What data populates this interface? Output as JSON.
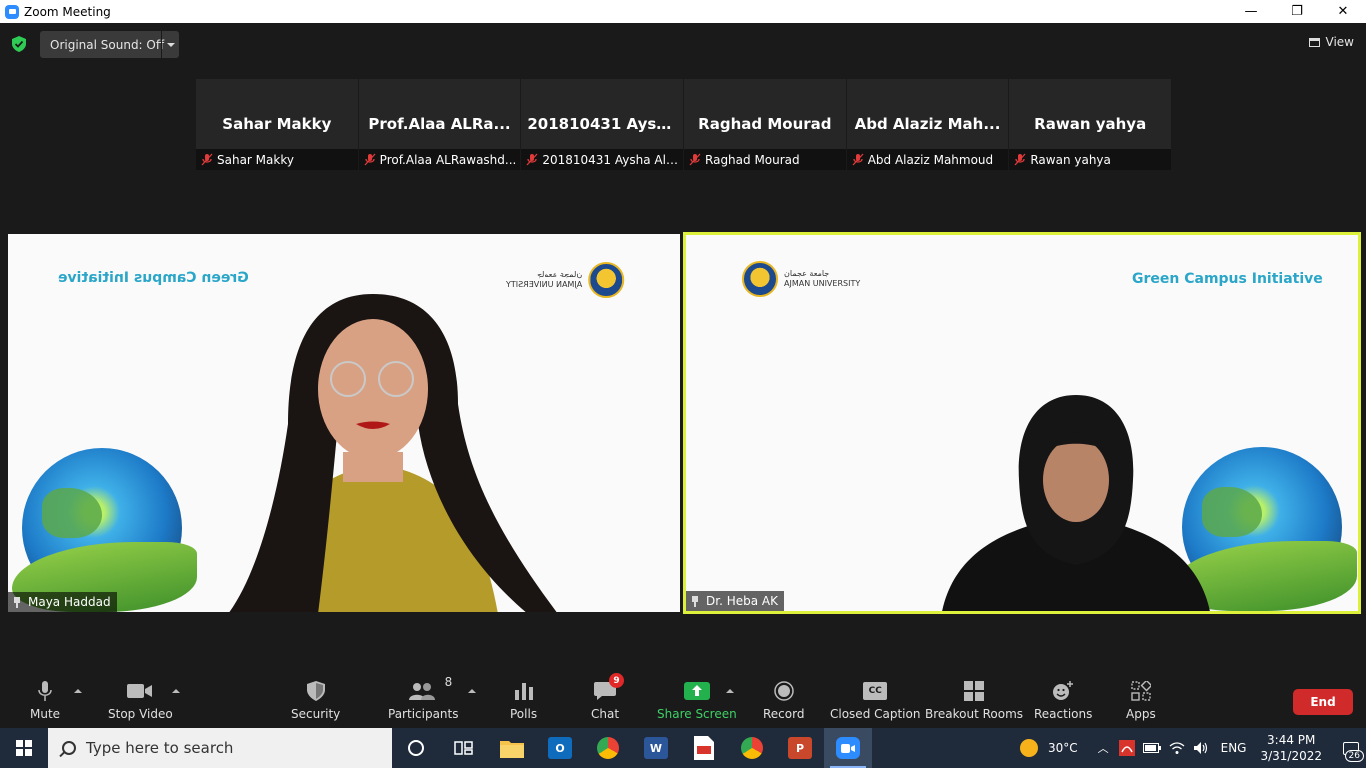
{
  "window": {
    "title": "Zoom Meeting",
    "minimize": "—",
    "restore": "❐",
    "close": "✕"
  },
  "top_bar": {
    "original_sound": "Original Sound: Off",
    "view_label": "View"
  },
  "participants_strip": [
    {
      "display": "Sahar Makky",
      "name": "Sahar Makky"
    },
    {
      "display": "Prof.Alaa ALRa...",
      "name": "Prof.Alaa ALRawashd..."
    },
    {
      "display": "201810431 Aysh...",
      "name": "201810431 Aysha Als..."
    },
    {
      "display": "Raghad Mourad",
      "name": "Raghad Mourad"
    },
    {
      "display": "Abd Alaziz Mah...",
      "name": "Abd Alaziz Mahmoud"
    },
    {
      "display": "Rawan yahya",
      "name": "Rawan yahya"
    }
  ],
  "videos": {
    "left": {
      "name": "Maya Haddad",
      "banner": "Green Campus Initiative",
      "logo_ar": "جامعة عجمان",
      "logo_en": "AJMAN UNIVERSITY"
    },
    "right": {
      "name": "Dr. Heba AK",
      "banner": "Green Campus Initiative",
      "logo_ar": "جامعة عجمان",
      "logo_en": "AJMAN UNIVERSITY"
    }
  },
  "toolbar": {
    "mute": "Mute",
    "stop_video": "Stop Video",
    "security": "Security",
    "participants": "Participants",
    "participants_count": "8",
    "polls": "Polls",
    "chat": "Chat",
    "chat_badge": "9",
    "share_screen": "Share Screen",
    "record": "Record",
    "closed_caption": "Closed Caption",
    "cc_icon_text": "CC",
    "breakout_rooms": "Breakout Rooms",
    "reactions": "Reactions",
    "apps": "Apps",
    "end": "End"
  },
  "taskbar": {
    "search_placeholder": "Type here to search",
    "weather": "30°C",
    "language": "ENG",
    "time": "3:44 PM",
    "date": "3/31/2022",
    "notifications": "26",
    "apps": [
      {
        "name": "cortana",
        "color": "#1f2a3a",
        "glyph": "○"
      },
      {
        "name": "task-view",
        "color": "#1f2a3a",
        "glyph": "⧉"
      },
      {
        "name": "file-explorer",
        "color": "#f5c34a",
        "glyph": ""
      },
      {
        "name": "outlook",
        "color": "#0f6cbd",
        "glyph": "O"
      },
      {
        "name": "chrome-m",
        "color": "#2e9c4a",
        "glyph": "M"
      },
      {
        "name": "word",
        "color": "#2b579a",
        "glyph": "W"
      },
      {
        "name": "pdf",
        "color": "#d8342b",
        "glyph": ""
      },
      {
        "name": "chrome-e",
        "color": "#2e9c4a",
        "glyph": "E"
      },
      {
        "name": "powerpoint",
        "color": "#c9472b",
        "glyph": "P"
      },
      {
        "name": "zoom",
        "color": "#2d8cff",
        "glyph": ""
      }
    ]
  },
  "colors": {
    "accent_green": "#3ed167",
    "speaker_border": "#ddf03a",
    "end_red": "#d02a2a",
    "zoom_blue": "#2d8cff"
  }
}
